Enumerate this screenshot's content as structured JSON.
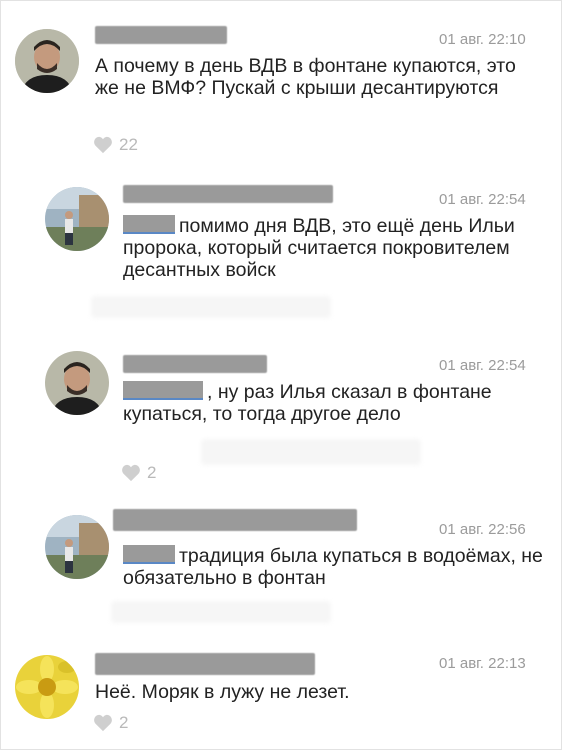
{
  "comments": [
    {
      "time": "01 авг. 22:10",
      "text": "А почему в день ВДВ в фонтане купаются, это же не ВМФ? Пускай с крыши десантируются",
      "likes": "22",
      "avatar_icon": "man-portrait-avatar"
    },
    {
      "time": "01 авг. 22:54",
      "text": "помимо дня ВДВ, это ещё день Ильи пророка, который считается покровителем десантных войск",
      "avatar_icon": "outdoor-person-avatar"
    },
    {
      "time": "01 авг. 22:54",
      "text": ", ну раз Илья сказал в фонтане купаться, то тогда другое дело",
      "likes": "2",
      "avatar_icon": "man-portrait-avatar"
    },
    {
      "time": "01 авг. 22:56",
      "text": "традиция была купаться в водоёмах, не обязательно в фонтан",
      "avatar_icon": "outdoor-person-avatar"
    },
    {
      "time": "01 авг. 22:13",
      "text": "Неё. Моряк в лужу не лезет.",
      "likes": "2",
      "avatar_icon": "yellow-flower-avatar"
    }
  ],
  "colors": {
    "text": "#222222",
    "meta": "#9b9b9b",
    "like": "#b9b9b9",
    "mention": "#5a88c5",
    "redaction": "#9a9a9a"
  }
}
